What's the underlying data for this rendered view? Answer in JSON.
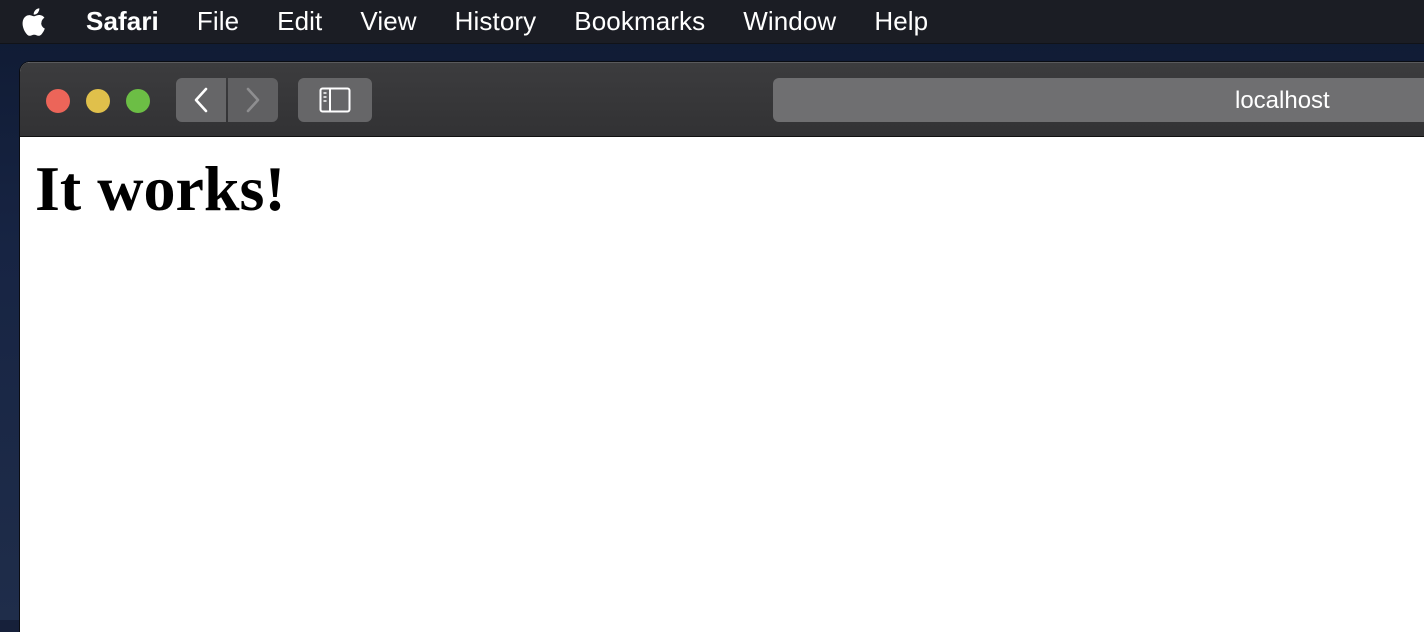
{
  "menubar": {
    "apple_icon": "apple-logo",
    "app_name": "Safari",
    "items": [
      "File",
      "Edit",
      "View",
      "History",
      "Bookmarks",
      "Window",
      "Help"
    ]
  },
  "window": {
    "traffic_lights": {
      "close_color": "#ec6559",
      "minimize_color": "#e0c04b",
      "maximize_color": "#6cbe45"
    },
    "toolbar": {
      "back_icon": "chevron-left",
      "forward_icon": "chevron-right",
      "sidebar_icon": "sidebar"
    },
    "address_bar": {
      "url": "localhost"
    }
  },
  "page": {
    "heading": "It works!"
  }
}
